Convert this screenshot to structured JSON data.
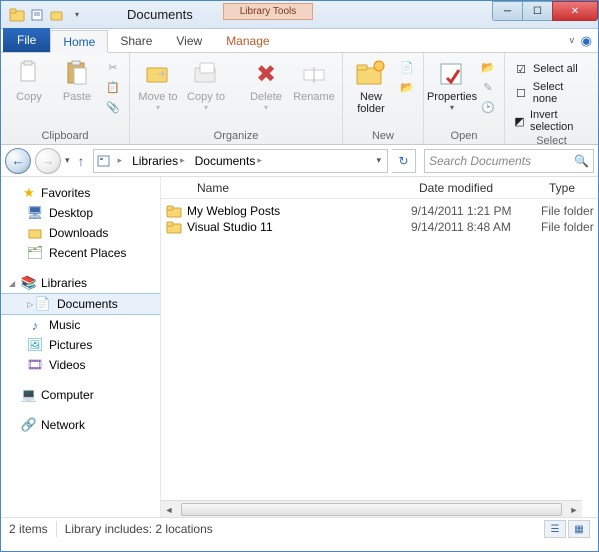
{
  "window": {
    "title": "Documents",
    "contextual_group": "Library Tools"
  },
  "tabs": {
    "file": "File",
    "home": "Home",
    "share": "Share",
    "view": "View",
    "manage": "Manage"
  },
  "ribbon": {
    "clipboard": {
      "label": "Clipboard",
      "copy": "Copy",
      "paste": "Paste"
    },
    "organize": {
      "label": "Organize",
      "move_to": "Move to",
      "copy_to": "Copy to",
      "delete": "Delete",
      "rename": "Rename"
    },
    "new": {
      "label": "New",
      "new_folder": "New folder"
    },
    "open": {
      "label": "Open",
      "properties": "Properties"
    },
    "select": {
      "label": "Select",
      "select_all": "Select all",
      "select_none": "Select none",
      "invert": "Invert selection"
    }
  },
  "breadcrumb": {
    "items": [
      "Libraries",
      "Documents"
    ]
  },
  "search": {
    "placeholder": "Search Documents"
  },
  "sidebar": {
    "favorites": {
      "label": "Favorites",
      "items": [
        "Desktop",
        "Downloads",
        "Recent Places"
      ]
    },
    "libraries": {
      "label": "Libraries",
      "items": [
        "Documents",
        "Music",
        "Pictures",
        "Videos"
      ],
      "selected": "Documents"
    },
    "computer": "Computer",
    "network": "Network"
  },
  "columns": {
    "name": "Name",
    "date": "Date modified",
    "type": "Type"
  },
  "files": [
    {
      "name": "My Weblog Posts",
      "date": "9/14/2011 1:21 PM",
      "type": "File folder"
    },
    {
      "name": "Visual Studio 11",
      "date": "9/14/2011 8:48 AM",
      "type": "File folder"
    }
  ],
  "status": {
    "count": "2 items",
    "locations": "Library includes: 2 locations"
  }
}
